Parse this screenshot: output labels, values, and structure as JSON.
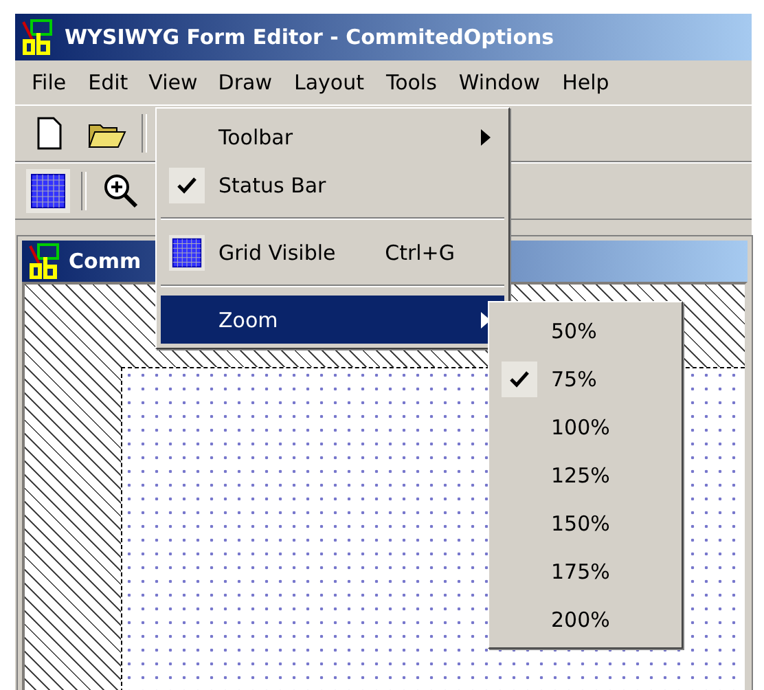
{
  "window": {
    "title": "WYSIWYG Form Editor - CommitedOptions"
  },
  "menu_bar": [
    {
      "label": "File",
      "selected": false
    },
    {
      "label": "Edit",
      "selected": false
    },
    {
      "label": "View",
      "selected": true
    },
    {
      "label": "Draw",
      "selected": false
    },
    {
      "label": "Layout",
      "selected": false
    },
    {
      "label": "Tools",
      "selected": false
    },
    {
      "label": "Window",
      "selected": false
    },
    {
      "label": "Help",
      "selected": false
    }
  ],
  "toolbar": {
    "grid_pressed": true
  },
  "child_window": {
    "title": "Comm"
  },
  "view_menu": [
    {
      "kind": "submenu",
      "label": "Toolbar",
      "selected": false
    },
    {
      "kind": "check",
      "label": "Status Bar",
      "checked": true
    },
    {
      "kind": "separator"
    },
    {
      "kind": "icon",
      "label": "Grid Visible",
      "shortcut": "Ctrl+G",
      "checked": true
    },
    {
      "kind": "separator"
    },
    {
      "kind": "submenu",
      "label": "Zoom",
      "selected": true
    }
  ],
  "zoom_menu": [
    {
      "label": "50%",
      "checked": false
    },
    {
      "label": "75%",
      "checked": true
    },
    {
      "label": "100%",
      "checked": false
    },
    {
      "label": "125%",
      "checked": false
    },
    {
      "label": "150%",
      "checked": false
    },
    {
      "label": "175%",
      "checked": false
    },
    {
      "label": "200%",
      "checked": false
    }
  ]
}
